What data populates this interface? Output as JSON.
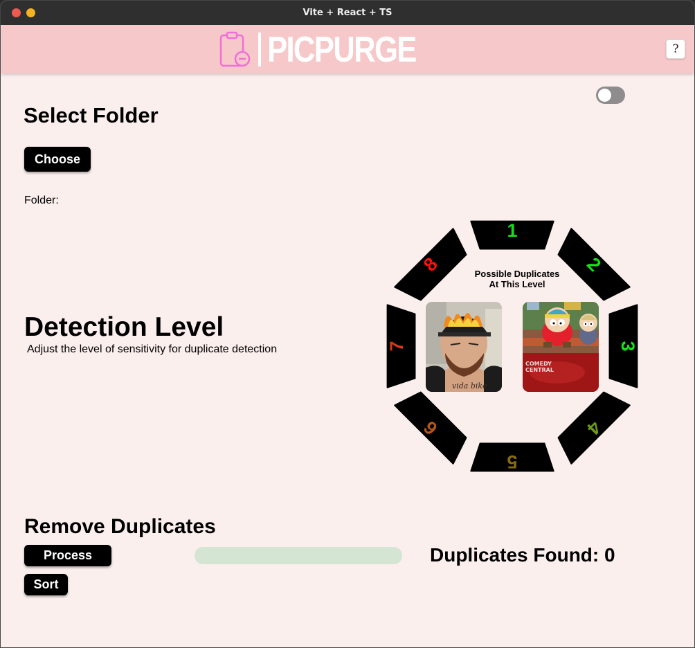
{
  "window": {
    "title": "Vite + React + TS"
  },
  "header": {
    "logo_text": "PICPURGE",
    "help_label": "?"
  },
  "theme_toggle": {
    "on": false
  },
  "select_folder": {
    "title": "Select Folder",
    "choose_label": "Choose",
    "folder_label": "Folder:"
  },
  "detection": {
    "title": "Detection Level",
    "subtitle": "Adjust the level of sensitivity for duplicate detection",
    "preview_caption_line1": "Possible Duplicates",
    "preview_caption_line2": "At This Level",
    "levels": [
      {
        "label": "1",
        "color": "#18e018"
      },
      {
        "label": "2",
        "color": "#18e018"
      },
      {
        "label": "3",
        "color": "#18e018"
      },
      {
        "label": "4",
        "color": "#6c9a16"
      },
      {
        "label": "5",
        "color": "#8a6a10"
      },
      {
        "label": "6",
        "color": "#b4561a"
      },
      {
        "label": "7",
        "color": "#d4391a"
      },
      {
        "label": "8",
        "color": "#ff1010"
      }
    ]
  },
  "remove": {
    "title": "Remove Duplicates",
    "process_label": "Process",
    "sort_label": "Sort",
    "progress": 0,
    "duplicates_label": "Duplicates Found: 0"
  }
}
